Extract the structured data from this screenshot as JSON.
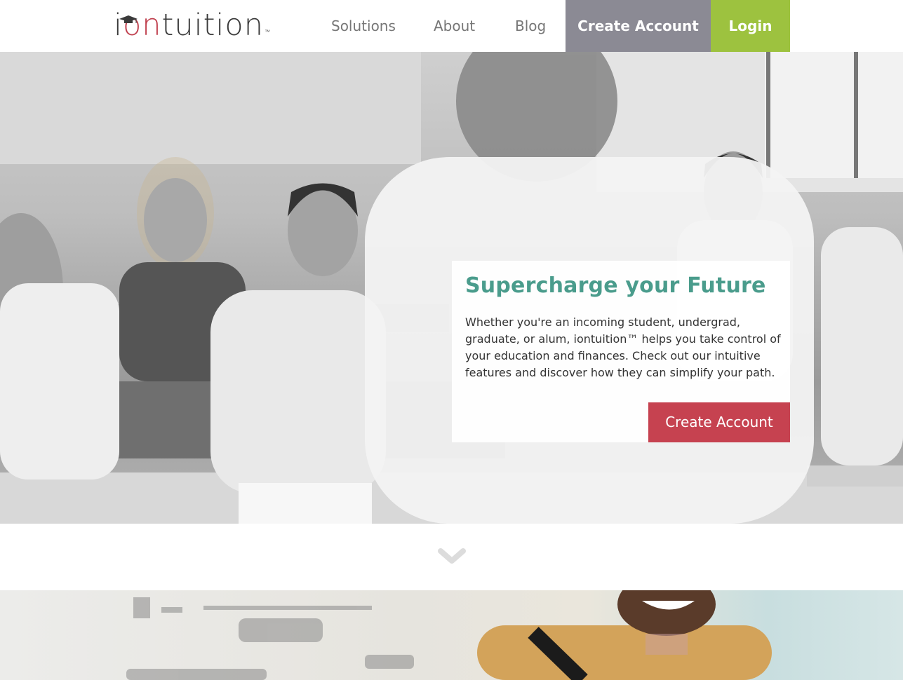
{
  "logo": {
    "pre": "i",
    "red": "on",
    "post": "tuition",
    "tm": "™"
  },
  "nav": {
    "solutions": "Solutions",
    "about": "About",
    "blog": "Blog",
    "create_account": "Create Account",
    "login": "Login"
  },
  "hero": {
    "title": "Supercharge your Future",
    "text": "Whether you're an incoming student, undergrad, graduate, or alum, iontuition™ helps you take control of your education and finances. Check out our intuitive features and discover how they can simplify your path.",
    "cta": "Create Account"
  },
  "icons": {
    "scroll": "chevron-down-icon",
    "logo_accent": "graduation-cap-icon"
  },
  "colors": {
    "brand_red": "#c64250",
    "brand_green": "#9dc23f",
    "nav_gray": "#8b8a94",
    "title_teal": "#4a9c8c"
  }
}
